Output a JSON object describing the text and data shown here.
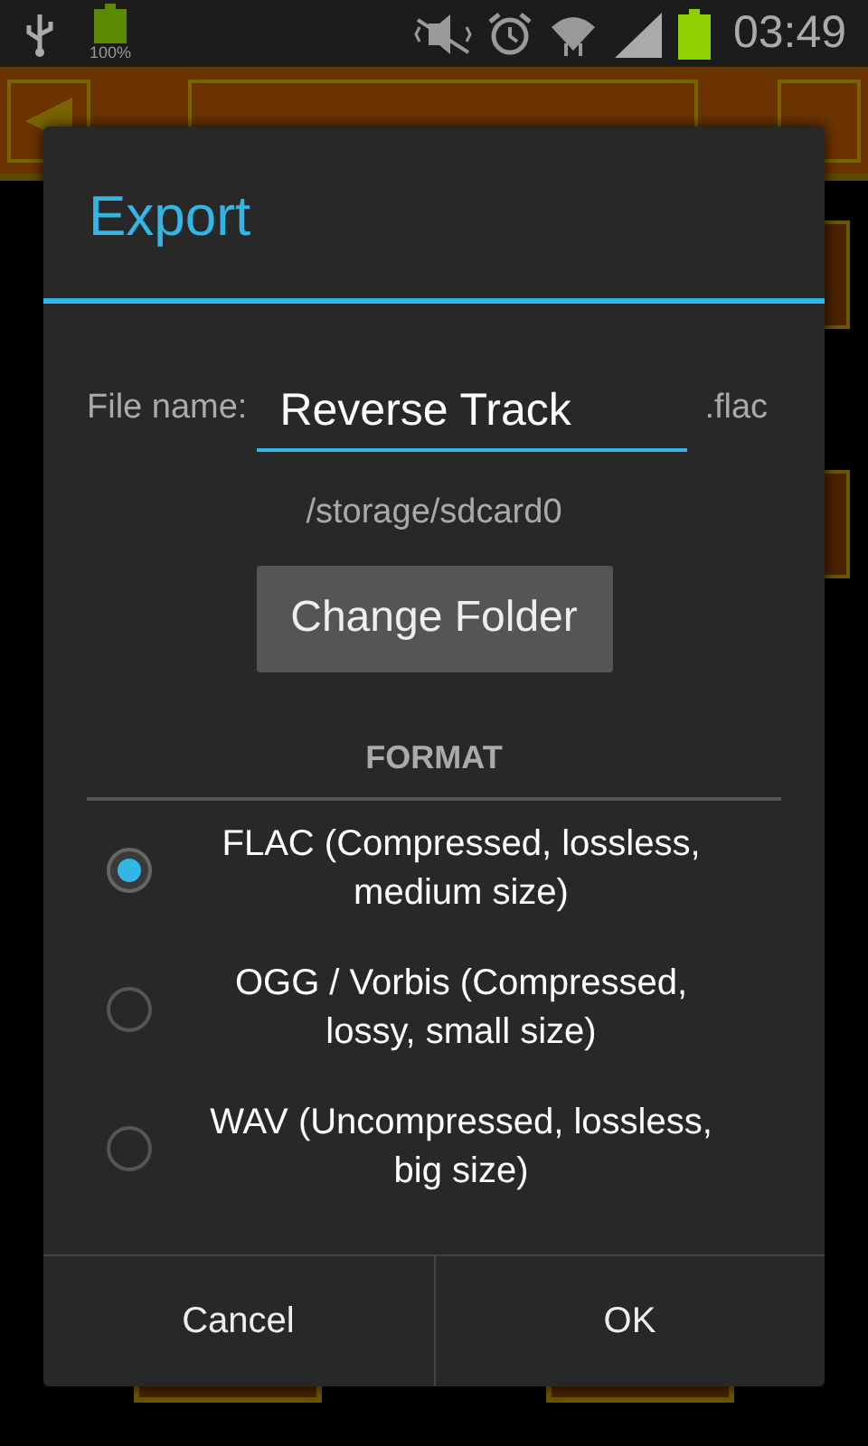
{
  "status_bar": {
    "battery_label": "100%",
    "time": "03:49"
  },
  "dialog": {
    "title": "Export",
    "file_name_label": "File name:",
    "file_name": "Reverse Track",
    "extension": ".flac",
    "folder": "/storage/sdcard0",
    "change_folder_button": "Change Folder",
    "format_heading": "FORMAT",
    "formats": [
      {
        "label": "FLAC (Compressed, lossless, medium size)",
        "selected": true
      },
      {
        "label": "OGG / Vorbis (Compressed, lossy, small size)",
        "selected": false
      },
      {
        "label": "WAV (Uncompressed, lossless, big size)",
        "selected": false
      }
    ],
    "buttons": [
      "Cancel",
      "OK"
    ]
  }
}
